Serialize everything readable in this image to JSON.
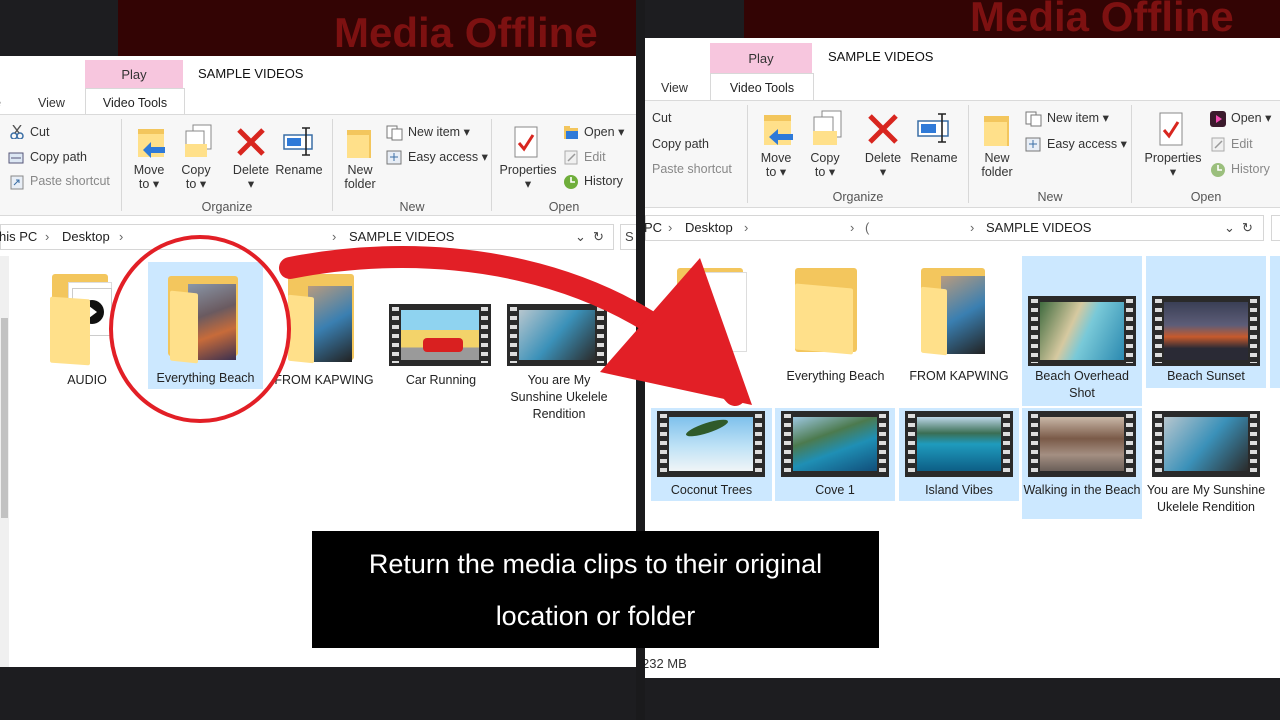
{
  "banner": {
    "text": "Media Offline"
  },
  "left": {
    "context_tab": "Play",
    "title": "SAMPLE VIDEOS",
    "tabs": {
      "view": "View",
      "video_tools": "Video Tools"
    },
    "clipboard": {
      "cut": "Cut",
      "copy_path": "Copy path",
      "paste_shortcut": "Paste shortcut"
    },
    "organize": {
      "move_to": "Move",
      "move_to2": "to",
      "copy_to": "Copy",
      "copy_to2": "to",
      "delete": "Delete",
      "rename": "Rename",
      "group": "Organize"
    },
    "new": {
      "new_folder": "New",
      "new_folder2": "folder",
      "new_item": "New item",
      "easy_access": "Easy access",
      "group": "New"
    },
    "open": {
      "properties": "Properties",
      "open": "Open",
      "edit": "Edit",
      "history": "History",
      "group": "Open"
    },
    "address": {
      "this_pc": "his PC",
      "desktop": "Desktop",
      "folder": "SAMPLE VIDEOS"
    },
    "items": [
      {
        "label": "AUDIO"
      },
      {
        "label": "Everything Beach"
      },
      {
        "label": "FROM KAPWING"
      },
      {
        "label": "Car Running"
      },
      {
        "label": "You are My Sunshine Ukelele Rendition"
      }
    ]
  },
  "right": {
    "context_tab": "Play",
    "title": "SAMPLE VIDEOS",
    "tabs": {
      "view": "View",
      "video_tools": "Video Tools"
    },
    "clipboard": {
      "cut": "Cut",
      "copy_path": "Copy path",
      "paste_shortcut": "Paste shortcut"
    },
    "organize": {
      "move_to": "Move",
      "move_to2": "to",
      "copy_to": "Copy",
      "copy_to2": "to",
      "delete": "Delete",
      "rename": "Rename",
      "group": "Organize"
    },
    "new": {
      "new_folder": "New",
      "new_folder2": "folder",
      "new_item": "New item",
      "easy_access": "Easy access",
      "group": "New"
    },
    "open": {
      "properties": "Properties",
      "open": "Open",
      "edit": "Edit",
      "history": "History",
      "group": "Open"
    },
    "address": {
      "this_pc": "PC",
      "desktop": "Desktop",
      "ellipsis": "(",
      "folder": "SAMPLE VIDEOS"
    },
    "status": "232 MB",
    "items_row1": [
      {
        "label": "AU"
      },
      {
        "label": "Everything Beach"
      },
      {
        "label": "FROM KAPWING"
      },
      {
        "label": "Beach Overhead Shot"
      },
      {
        "label": "Beach Sunset"
      }
    ],
    "items_row2": [
      {
        "label": "Coconut Trees"
      },
      {
        "label": "Cove 1"
      },
      {
        "label": "Island Vibes"
      },
      {
        "label": "Walking in the Beach"
      },
      {
        "label": "You are My Sunshine Ukelele Rendition"
      }
    ]
  },
  "caption": "Return the media clips to their original location or folder",
  "colors": {
    "annotation_red": "#e21f26",
    "selection": "#cce8ff",
    "context_tab": "#f7c6de"
  }
}
